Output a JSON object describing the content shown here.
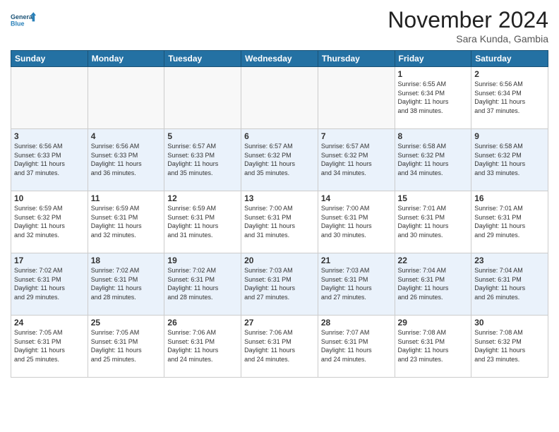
{
  "logo": {
    "line1": "General",
    "line2": "Blue"
  },
  "title": "November 2024",
  "subtitle": "Sara Kunda, Gambia",
  "days_of_week": [
    "Sunday",
    "Monday",
    "Tuesday",
    "Wednesday",
    "Thursday",
    "Friday",
    "Saturday"
  ],
  "weeks": [
    [
      {
        "day": "",
        "info": ""
      },
      {
        "day": "",
        "info": ""
      },
      {
        "day": "",
        "info": ""
      },
      {
        "day": "",
        "info": ""
      },
      {
        "day": "",
        "info": ""
      },
      {
        "day": "1",
        "info": "Sunrise: 6:55 AM\nSunset: 6:34 PM\nDaylight: 11 hours\nand 38 minutes."
      },
      {
        "day": "2",
        "info": "Sunrise: 6:56 AM\nSunset: 6:34 PM\nDaylight: 11 hours\nand 37 minutes."
      }
    ],
    [
      {
        "day": "3",
        "info": "Sunrise: 6:56 AM\nSunset: 6:33 PM\nDaylight: 11 hours\nand 37 minutes."
      },
      {
        "day": "4",
        "info": "Sunrise: 6:56 AM\nSunset: 6:33 PM\nDaylight: 11 hours\nand 36 minutes."
      },
      {
        "day": "5",
        "info": "Sunrise: 6:57 AM\nSunset: 6:33 PM\nDaylight: 11 hours\nand 35 minutes."
      },
      {
        "day": "6",
        "info": "Sunrise: 6:57 AM\nSunset: 6:32 PM\nDaylight: 11 hours\nand 35 minutes."
      },
      {
        "day": "7",
        "info": "Sunrise: 6:57 AM\nSunset: 6:32 PM\nDaylight: 11 hours\nand 34 minutes."
      },
      {
        "day": "8",
        "info": "Sunrise: 6:58 AM\nSunset: 6:32 PM\nDaylight: 11 hours\nand 34 minutes."
      },
      {
        "day": "9",
        "info": "Sunrise: 6:58 AM\nSunset: 6:32 PM\nDaylight: 11 hours\nand 33 minutes."
      }
    ],
    [
      {
        "day": "10",
        "info": "Sunrise: 6:59 AM\nSunset: 6:32 PM\nDaylight: 11 hours\nand 32 minutes."
      },
      {
        "day": "11",
        "info": "Sunrise: 6:59 AM\nSunset: 6:31 PM\nDaylight: 11 hours\nand 32 minutes."
      },
      {
        "day": "12",
        "info": "Sunrise: 6:59 AM\nSunset: 6:31 PM\nDaylight: 11 hours\nand 31 minutes."
      },
      {
        "day": "13",
        "info": "Sunrise: 7:00 AM\nSunset: 6:31 PM\nDaylight: 11 hours\nand 31 minutes."
      },
      {
        "day": "14",
        "info": "Sunrise: 7:00 AM\nSunset: 6:31 PM\nDaylight: 11 hours\nand 30 minutes."
      },
      {
        "day": "15",
        "info": "Sunrise: 7:01 AM\nSunset: 6:31 PM\nDaylight: 11 hours\nand 30 minutes."
      },
      {
        "day": "16",
        "info": "Sunrise: 7:01 AM\nSunset: 6:31 PM\nDaylight: 11 hours\nand 29 minutes."
      }
    ],
    [
      {
        "day": "17",
        "info": "Sunrise: 7:02 AM\nSunset: 6:31 PM\nDaylight: 11 hours\nand 29 minutes."
      },
      {
        "day": "18",
        "info": "Sunrise: 7:02 AM\nSunset: 6:31 PM\nDaylight: 11 hours\nand 28 minutes."
      },
      {
        "day": "19",
        "info": "Sunrise: 7:02 AM\nSunset: 6:31 PM\nDaylight: 11 hours\nand 28 minutes."
      },
      {
        "day": "20",
        "info": "Sunrise: 7:03 AM\nSunset: 6:31 PM\nDaylight: 11 hours\nand 27 minutes."
      },
      {
        "day": "21",
        "info": "Sunrise: 7:03 AM\nSunset: 6:31 PM\nDaylight: 11 hours\nand 27 minutes."
      },
      {
        "day": "22",
        "info": "Sunrise: 7:04 AM\nSunset: 6:31 PM\nDaylight: 11 hours\nand 26 minutes."
      },
      {
        "day": "23",
        "info": "Sunrise: 7:04 AM\nSunset: 6:31 PM\nDaylight: 11 hours\nand 26 minutes."
      }
    ],
    [
      {
        "day": "24",
        "info": "Sunrise: 7:05 AM\nSunset: 6:31 PM\nDaylight: 11 hours\nand 25 minutes."
      },
      {
        "day": "25",
        "info": "Sunrise: 7:05 AM\nSunset: 6:31 PM\nDaylight: 11 hours\nand 25 minutes."
      },
      {
        "day": "26",
        "info": "Sunrise: 7:06 AM\nSunset: 6:31 PM\nDaylight: 11 hours\nand 24 minutes."
      },
      {
        "day": "27",
        "info": "Sunrise: 7:06 AM\nSunset: 6:31 PM\nDaylight: 11 hours\nand 24 minutes."
      },
      {
        "day": "28",
        "info": "Sunrise: 7:07 AM\nSunset: 6:31 PM\nDaylight: 11 hours\nand 24 minutes."
      },
      {
        "day": "29",
        "info": "Sunrise: 7:08 AM\nSunset: 6:31 PM\nDaylight: 11 hours\nand 23 minutes."
      },
      {
        "day": "30",
        "info": "Sunrise: 7:08 AM\nSunset: 6:32 PM\nDaylight: 11 hours\nand 23 minutes."
      }
    ]
  ]
}
